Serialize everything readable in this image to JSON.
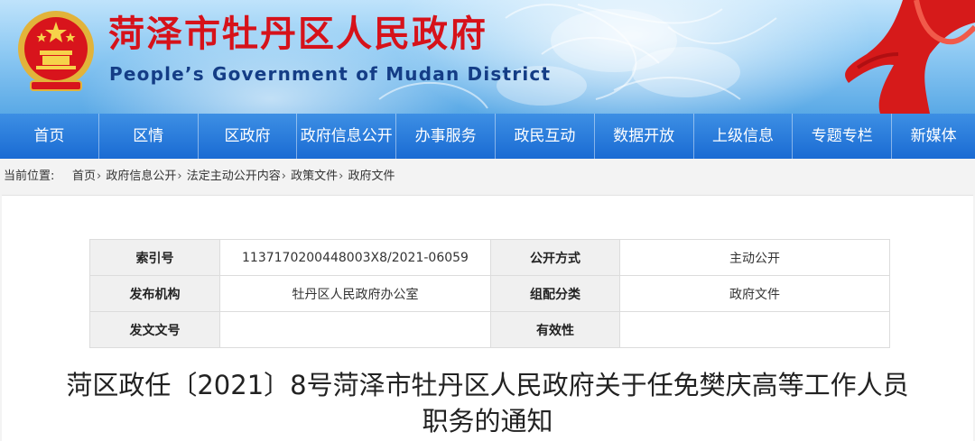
{
  "header": {
    "title": "菏泽市牡丹区人民政府",
    "subtitle": "People’s Government of Mudan District"
  },
  "colors": {
    "title_red": "#d6121a",
    "nav_blue": "#1a6bd3",
    "subtitle_navy": "#143d86"
  },
  "icons": {
    "emblem": "national-emblem-icon",
    "ribbon": "red-ribbon-sculpture-icon"
  },
  "nav": {
    "items": [
      {
        "label": "首页"
      },
      {
        "label": "区情"
      },
      {
        "label": "区政府"
      },
      {
        "label": "政府信息公开"
      },
      {
        "label": "办事服务"
      },
      {
        "label": "政民互动"
      },
      {
        "label": "数据开放"
      },
      {
        "label": "上级信息"
      },
      {
        "label": "专题专栏"
      },
      {
        "label": "新媒体"
      }
    ]
  },
  "breadcrumb": {
    "lead": "当前位置:",
    "items": [
      {
        "label": "首页"
      },
      {
        "label": "政府信息公开"
      },
      {
        "label": "法定主动公开内容"
      },
      {
        "label": "政策文件"
      },
      {
        "label": "政府文件"
      }
    ],
    "separator": "›"
  },
  "meta": {
    "index_label": "索引号",
    "index_value": "1137170200448003X8/2021-06059",
    "open_method_label": "公开方式",
    "open_method_value": "主动公开",
    "publisher_label": "发布机构",
    "publisher_value": "牡丹区人民政府办公室",
    "category_label": "组配分类",
    "category_value": "政府文件",
    "doc_number_label": "发文文号",
    "doc_number_value": "",
    "validity_label": "有效性",
    "validity_value": ""
  },
  "document": {
    "title_line1": "菏区政任〔2021〕8号菏泽市牡丹区人民政府关于任免樊庆高等工作人员",
    "title_line2": "职务的通知"
  }
}
